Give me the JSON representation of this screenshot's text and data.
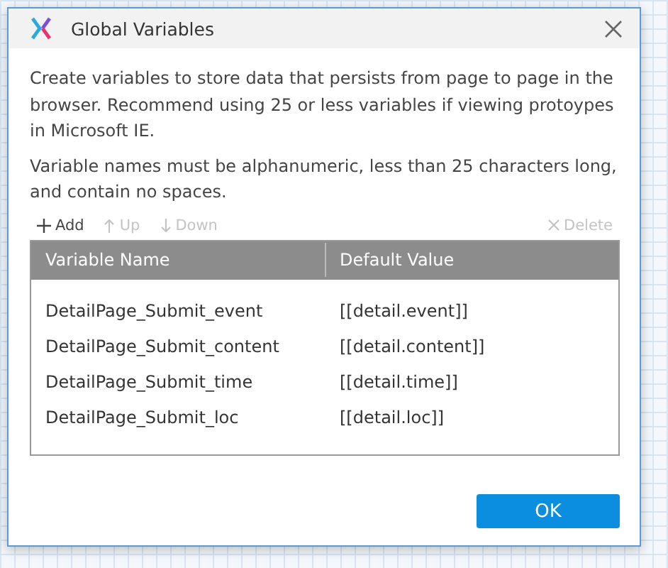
{
  "window": {
    "title": "Global Variables"
  },
  "description": [
    "Create variables to store data that persists from page to page in the browser. Recommend using 25 or less variables if viewing protoypes in Microsoft IE.",
    "Variable names must be alphanumeric, less than 25 characters long, and contain no spaces."
  ],
  "toolbar": [
    {
      "kind": "add",
      "label": "Add",
      "disabled": false
    },
    {
      "kind": "up",
      "label": "Up",
      "disabled": true
    },
    {
      "kind": "down",
      "label": "Down",
      "disabled": true
    },
    {
      "kind": "delete",
      "label": "Delete",
      "disabled": true
    }
  ],
  "table": {
    "columns": [
      "Variable Name",
      "Default Value"
    ],
    "rows": [
      {
        "name": "DetailPage_Submit_event",
        "value": "[[detail.event]]"
      },
      {
        "name": "DetailPage_Submit_content",
        "value": "[[detail.content]]"
      },
      {
        "name": "DetailPage_Submit_time",
        "value": "[[detail.time]]"
      },
      {
        "name": "DetailPage_Submit_loc",
        "value": "[[detail.loc]]"
      }
    ]
  },
  "buttons": [
    "OK"
  ]
}
